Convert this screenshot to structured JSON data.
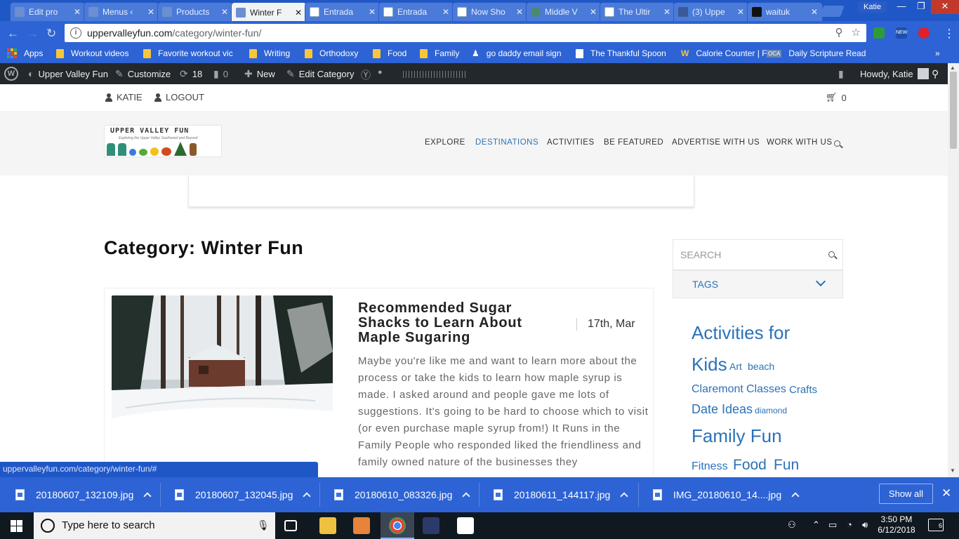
{
  "browser": {
    "tabs": [
      {
        "title": "Edit pro",
        "favicon": "#6b8fd1"
      },
      {
        "title": "Menus ‹",
        "favicon": "#6b8fd1"
      },
      {
        "title": "Products",
        "favicon": "#6b8fd1"
      },
      {
        "title": "Winter F",
        "favicon": "#6b8fd1"
      },
      {
        "title": "Entrada",
        "favicon": "#ffffff"
      },
      {
        "title": "Entrada",
        "favicon": "#ffffff"
      },
      {
        "title": "Now Sho",
        "favicon": "#ffffff"
      },
      {
        "title": "Middle V",
        "favicon": "#4b8a6e"
      },
      {
        "title": "The Ultir",
        "favicon": "#ffffff"
      },
      {
        "title": "(3) Uppe",
        "favicon": "#3b5998"
      },
      {
        "title": "waituk",
        "favicon": "#111111"
      }
    ],
    "active_tab_index": 3,
    "profile_name": "Katie",
    "url_host": "uppervalleyfun.com",
    "url_path": "/category/winter-fun/",
    "bookmarks": [
      {
        "label": "Apps"
      },
      {
        "label": "Workout videos"
      },
      {
        "label": "Favorite workout vic"
      },
      {
        "label": "Writing"
      },
      {
        "label": "Orthodoxy"
      },
      {
        "label": "Food"
      },
      {
        "label": "Family"
      },
      {
        "label": "go daddy email sign"
      },
      {
        "label": "The Thankful Spoon"
      },
      {
        "label": "Calorie Counter | Fo"
      },
      {
        "label": "Daily Scripture Read"
      }
    ],
    "more_bookmarks": "»",
    "status_url": "uppervalleyfun.com/category/winter-fun/#"
  },
  "wp_admin_bar": {
    "site_name": "Upper Valley Fun",
    "customize": "Customize",
    "updates_count": "18",
    "comments_count": "0",
    "new_label": "New",
    "edit_category": "Edit Category",
    "greeting": "Howdy, Katie"
  },
  "site": {
    "user_label": "KATIE",
    "logout_label": "LOGOUT",
    "cart_count": "0",
    "logo_title": "UPPER VALLEY FUN",
    "logo_subtitle": "Exploring the Upper Valley Southward and Beyond",
    "nav": [
      {
        "label": "EXPLORE"
      },
      {
        "label": "DESTINATIONS"
      },
      {
        "label": "ACTIVITIES"
      },
      {
        "label": "BE FEATURED"
      },
      {
        "label": "ADVERTISE WITH US"
      },
      {
        "label": "WORK WITH US"
      }
    ],
    "active_nav_color": "#2b72b8"
  },
  "main": {
    "category_title": "Category: Winter Fun",
    "post": {
      "title": "Recommended Sugar Shacks to Learn About Maple Sugaring",
      "date": "17th, Mar",
      "excerpt": "Maybe you're like me and want to learn more about the process or take the kids to learn how maple syrup is made.  I asked around and people gave me lots of suggestions. It's going to be hard to choose which to visit (or even purchase maple syrup from!) It Runs in the Family People who responded liked the friendliness and family owned nature of the businesses they"
    }
  },
  "sidebar": {
    "search_placeholder": "SEARCH",
    "tags_label": "TAGS",
    "tags": [
      {
        "label": "Activities for"
      },
      {
        "label": "Kids"
      },
      {
        "label": "Art"
      },
      {
        "label": "beach"
      },
      {
        "label": "Claremont"
      },
      {
        "label": "Classes"
      },
      {
        "label": "Crafts"
      },
      {
        "label": "Date Ideas"
      },
      {
        "label": "diamond"
      },
      {
        "label": "Family Fun"
      },
      {
        "label": "Fitness"
      },
      {
        "label": "Food"
      },
      {
        "label": "Fun"
      }
    ]
  },
  "downloads": {
    "files": [
      {
        "name": "20180607_132109.jpg"
      },
      {
        "name": "20180607_132045.jpg"
      },
      {
        "name": "20180610_083326.jpg"
      },
      {
        "name": "20180611_144117.jpg"
      },
      {
        "name": "IMG_20180610_14....jpg"
      }
    ],
    "show_all": "Show all"
  },
  "taskbar": {
    "search_placeholder": "Type here to search",
    "time": "3:50 PM",
    "date": "6/12/2018",
    "notification_count": "6"
  }
}
